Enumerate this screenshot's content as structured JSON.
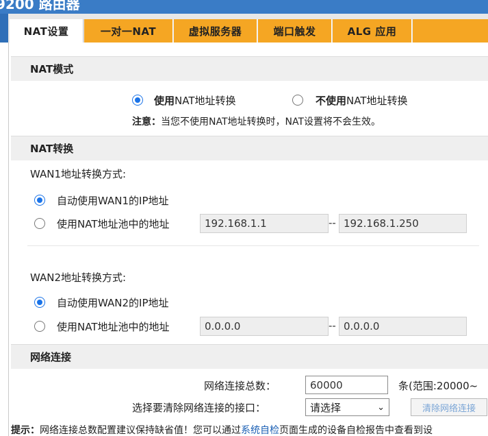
{
  "window": {
    "title": "9200 路由器"
  },
  "tabs": [
    {
      "label": "NAT设置",
      "active": true
    },
    {
      "label": "一对一NAT",
      "active": false
    },
    {
      "label": "虚拟服务器",
      "active": false
    },
    {
      "label": "端口触发",
      "active": false
    },
    {
      "label": "ALG 应用",
      "active": false
    }
  ],
  "nat_mode": {
    "header": "NAT模式",
    "option_use_bold": "使用",
    "option_use_rest": " NAT地址转换",
    "option_nouse_bold": "不使用",
    "option_nouse_rest": " NAT地址转换",
    "note_bold": "注意：",
    "note_text": "当您不使用NAT地址转换时，NAT设置将不会生效。",
    "selected": "use"
  },
  "nat_convert": {
    "header": "NAT转换",
    "wan1": {
      "label": "WAN1地址转换方式:",
      "option_auto": "自动使用WAN1的IP地址",
      "option_pool": "使用NAT地址池中的地址",
      "pool_start": "192.168.1.1",
      "pool_end": "192.168.1.250",
      "separator": "--",
      "selected": "auto"
    },
    "wan2": {
      "label": "WAN2地址转换方式:",
      "option_auto": "自动使用WAN2的IP地址",
      "option_pool": "使用NAT地址池中的地址",
      "pool_start": "0.0.0.0",
      "pool_end": "0.0.0.0",
      "separator": "--",
      "selected": "auto"
    }
  },
  "net_conn": {
    "header": "网络连接",
    "total_label": "网络连接总数：",
    "total_value": "60000",
    "range_text": "条(范围:20000~",
    "clear_label": "选择要清除网络连接的接口：",
    "select_value": "请选择",
    "clear_button": "清除网络连接"
  },
  "tip": {
    "bold": "提示：",
    "text_before": "网络连接总数配置建议保持缺省值！您可以通过",
    "link": "系统自检",
    "text_after": "页面生成的设备自检报告中查看到设"
  },
  "colors": {
    "brand_blue": "#3a7cc6",
    "tab_orange": "#f5a623",
    "radio_blue": "#1a73e8"
  }
}
